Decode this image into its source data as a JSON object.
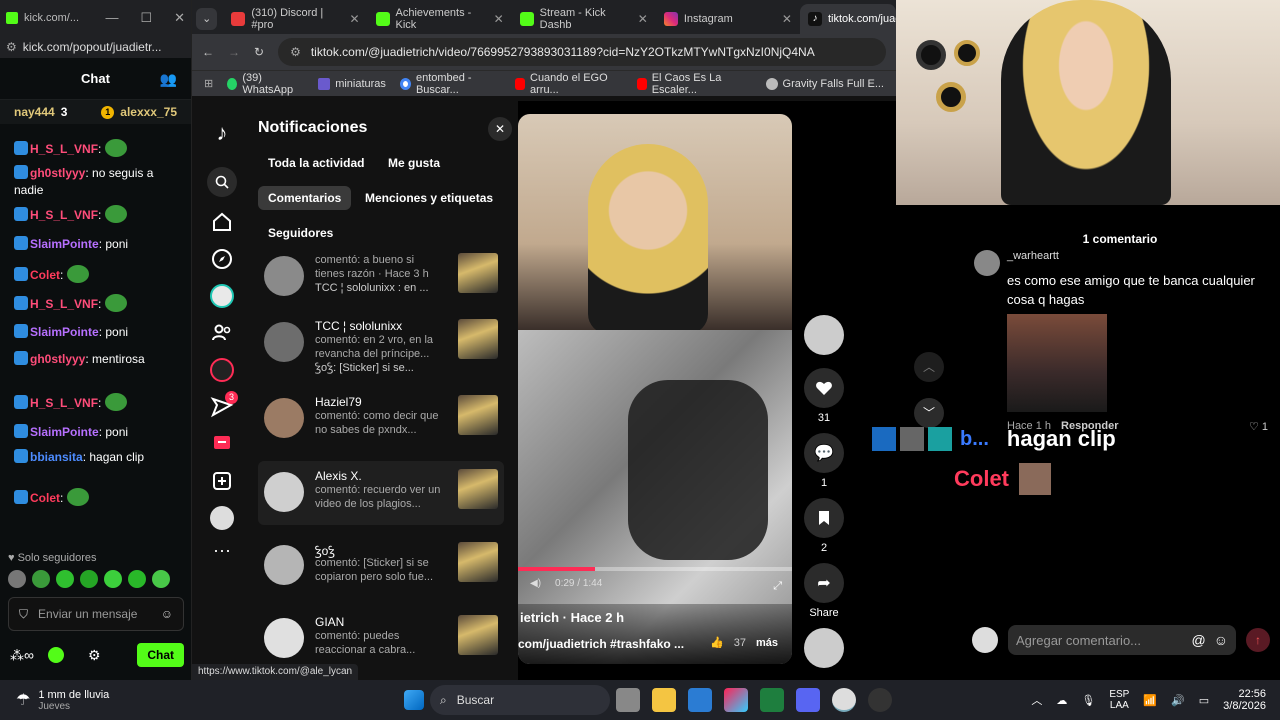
{
  "kick_window": {
    "title": "kick.com/...",
    "url": "kick.com/popout/juadietr...",
    "chat_title": "Chat",
    "pinned": [
      {
        "name": "nay444",
        "count": "3"
      },
      {
        "name": "alexxx_75",
        "count": "1"
      }
    ],
    "messages": [
      {
        "user": "H_S_L_VNF",
        "color": "#ff4d7a",
        "text": ""
      },
      {
        "user": "gh0stlyyy",
        "color": "#ff4d7a",
        "text": "no seguis a nadie"
      },
      {
        "user": "H_S_L_VNF",
        "color": "#ff4d7a",
        "text": ""
      },
      {
        "user": "SlaimPointe",
        "color": "#b770ff",
        "text": "poni"
      },
      {
        "user": "Colet",
        "color": "#ff3b5c",
        "text": ""
      },
      {
        "user": "H_S_L_VNF",
        "color": "#ff4d7a",
        "text": ""
      },
      {
        "user": "SlaimPointe",
        "color": "#b770ff",
        "text": "poni"
      },
      {
        "user": "gh0stlyyy",
        "color": "#ff4d7a",
        "text": "mentirosa"
      },
      {
        "user": "H_S_L_VNF",
        "color": "#ff4d7a",
        "text": ""
      },
      {
        "user": "SlaimPointe",
        "color": "#b770ff",
        "text": "poni"
      },
      {
        "user": "bbiansita",
        "color": "#4d8cff",
        "text": "hagan clip"
      },
      {
        "user": "Colet",
        "color": "#ff3b5c",
        "text": ""
      }
    ],
    "followers_only": "Solo seguidores",
    "input_placeholder": "Enviar un mensaje",
    "chat_button": "Chat",
    "brand_color": "#53fc18"
  },
  "browser": {
    "tabs": [
      {
        "label": "(310) Discord | #pro",
        "active": false
      },
      {
        "label": "Achievements - Kick",
        "active": false
      },
      {
        "label": "Stream - Kick Dashb",
        "active": false
      },
      {
        "label": "Instagram",
        "active": false
      },
      {
        "label": "tiktok.com/juad",
        "active": true
      }
    ],
    "url": "tiktok.com/@juadietrich/video/7669952793893031189?cid=NzY2OTkzMTYwNTgxNzI0NjQ4NA",
    "bookmarks": [
      "(39) WhatsApp",
      "miniaturas",
      "entombed - Buscar...",
      "Cuando el EGO arru...",
      "El Caos Es La Escaler...",
      "Gravity Falls Full E..."
    ],
    "status_url": "https://www.tiktok.com/@ale_lycan"
  },
  "tiktok": {
    "notifications": {
      "title": "Notificaciones",
      "filters": [
        "Toda la actividad",
        "Me gusta",
        "Comentarios",
        "Menciones y etiquetas",
        "Seguidores"
      ],
      "selected_filter": "Comentarios",
      "items": [
        {
          "name": "",
          "text": "comentó: a bueno si tienes razón · Hace 3 h",
          "extra": "TCC ¦ sololunixx : en ..."
        },
        {
          "name": "TCC ¦ sololunixx",
          "text": "comentó: en 2 vro, en la revancha del príncipe...",
          "extra": "ꝢoꝢ: [Sticker] si se..."
        },
        {
          "name": "Haziel79",
          "text": "comentó: como decir que no sabes de pxndx...",
          "extra": ""
        },
        {
          "name": "Alexis X.",
          "text": "comentó: recuerdo ver un video de los plagios...",
          "extra": ""
        },
        {
          "name": "ꝢoꝢ",
          "text": "comentó: [Sticker] si se copiaron pero solo fue...",
          "extra": ""
        },
        {
          "name": "GIAN",
          "text": "comentó: puedes reaccionar a cabra...",
          "extra": ""
        }
      ],
      "inbox_badge": "3"
    },
    "video": {
      "time": "0:29 / 1:44",
      "progress": 0.28,
      "author_line": "ietrich · Hace 2 h",
      "caption": "com/juadietrich #trashfako ...",
      "likes_small": "37",
      "more": "más",
      "overlay_text": "Hace 2 h"
    },
    "actions": {
      "likes": "31",
      "comments": "1",
      "saves": "2",
      "share": "Share"
    }
  },
  "stream_overlay": {
    "comment_count": "1 comentario",
    "comment_user": "_warheartt",
    "comment_text": "es como ese amigo que te banca cualquier cosa q hagas",
    "comment_time": "Hace 1 h",
    "reply": "Responder",
    "comment_likes": "1",
    "input_placeholder": "Agregar comentario...",
    "overlay_user": "b...",
    "overlay_msg": "hagan clip",
    "overlay_user2": "Colet"
  },
  "taskbar": {
    "weather_title": "1 mm de lluvia",
    "weather_sub": "Jueves",
    "search": "Buscar",
    "lang": "ESP",
    "lang_sub": "LAA",
    "time": "22:56",
    "date": "3/8/2026"
  }
}
